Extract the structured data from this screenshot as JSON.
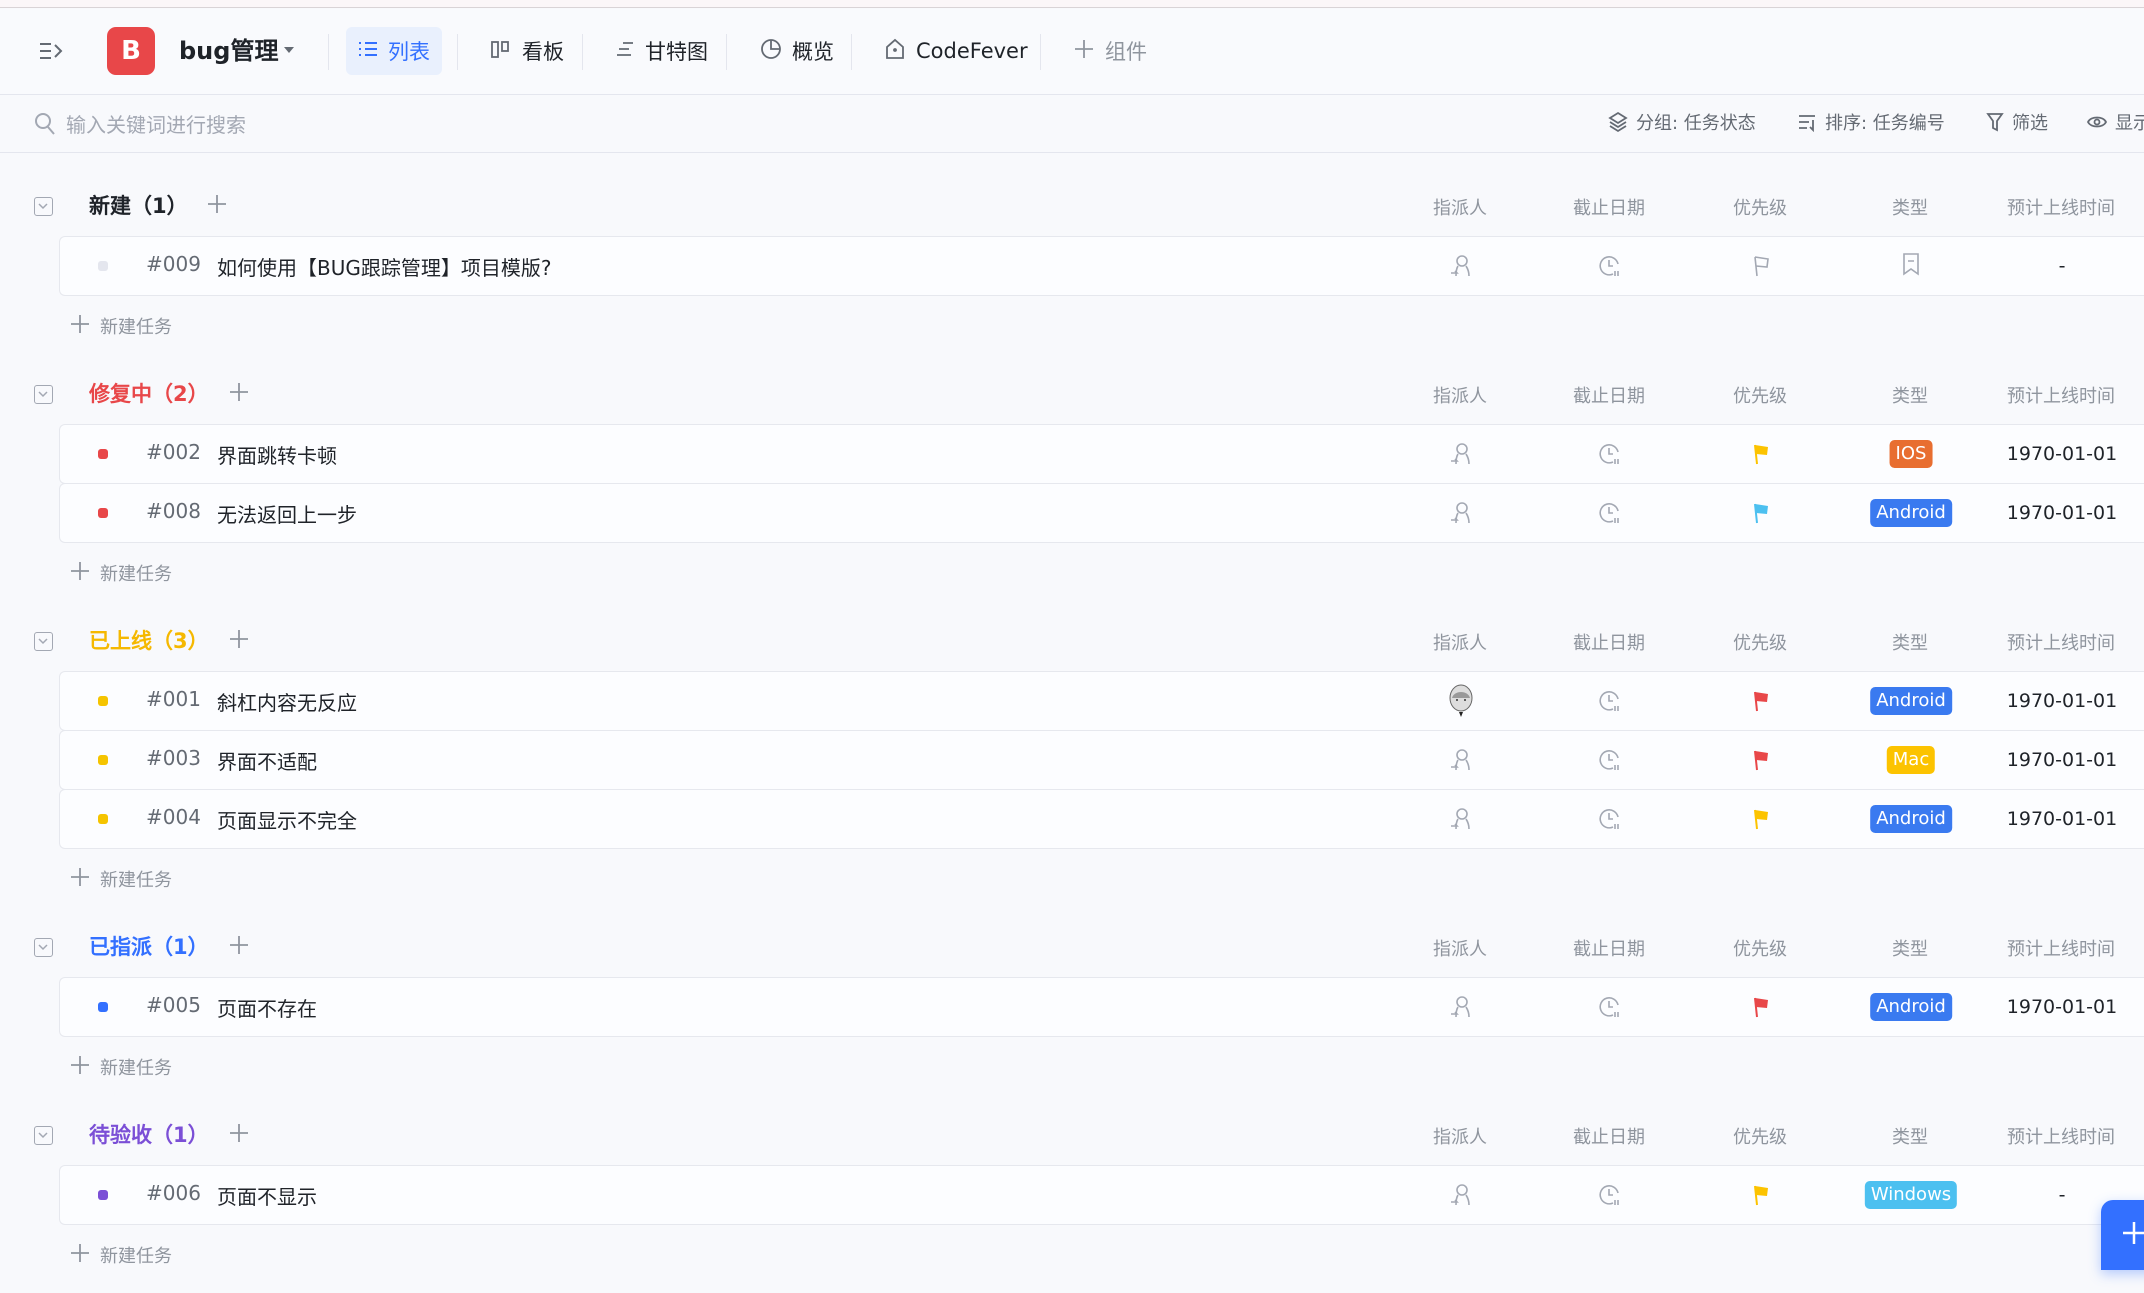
{
  "header": {
    "logo_letter": "B",
    "project_name": "bug管理",
    "tabs": [
      {
        "label": "列表",
        "icon": "list-icon",
        "active": true
      },
      {
        "label": "看板",
        "icon": "kanban-icon"
      },
      {
        "label": "甘特图",
        "icon": "gantt-icon"
      },
      {
        "label": "概览",
        "icon": "pie-chart-icon"
      },
      {
        "label": "CodeFever",
        "icon": "codefever-icon"
      },
      {
        "label": "组件",
        "icon": "plus-icon"
      }
    ]
  },
  "toolbar": {
    "search_placeholder": "输入关键词进行搜索",
    "group_label": "分组: 任务状态",
    "sort_label": "排序: 任务编号",
    "filter_label": "筛选",
    "display_label": "显示"
  },
  "columns": [
    "指派人",
    "截止日期",
    "优先级",
    "类型",
    "预计上线时间"
  ],
  "new_task_label": "新建任务",
  "groups": [
    {
      "title": "新建（1）",
      "color": "#1f2329",
      "dot": "#e4e6ee",
      "tasks": [
        {
          "id": "#009",
          "title": "如何使用【BUG跟踪管理】项目模版?",
          "priority": null,
          "type": null,
          "release": "-"
        }
      ]
    },
    {
      "title": "修复中（2）",
      "color": "#e84749",
      "dot": "#e84749",
      "tasks": [
        {
          "id": "#002",
          "title": "界面跳转卡顿",
          "priority": "#fcc300",
          "type": {
            "label": "IOS",
            "color": "#e86e30"
          },
          "release": "1970-01-01"
        },
        {
          "id": "#008",
          "title": "无法返回上一步",
          "priority": "#4cc0f0",
          "type": {
            "label": "Android",
            "color": "#3a7af0"
          },
          "release": "1970-01-01"
        }
      ]
    },
    {
      "title": "已上线（3）",
      "color": "#f5b800",
      "dot": "#f5c400",
      "tasks": [
        {
          "id": "#001",
          "title": "斜杠内容无反应",
          "assignee_avatar": true,
          "priority": "#e84749",
          "type": {
            "label": "Android",
            "color": "#3a7af0"
          },
          "release": "1970-01-01"
        },
        {
          "id": "#003",
          "title": "界面不适配",
          "priority": "#e84749",
          "type": {
            "label": "Mac",
            "color": "#fcc300"
          },
          "release": "1970-01-01"
        },
        {
          "id": "#004",
          "title": "页面显示不完全",
          "priority": "#fcc300",
          "type": {
            "label": "Android",
            "color": "#3a7af0"
          },
          "release": "1970-01-01"
        }
      ]
    },
    {
      "title": "已指派（1）",
      "color": "#3370ff",
      "dot": "#3370ff",
      "tasks": [
        {
          "id": "#005",
          "title": "页面不存在",
          "priority": "#e84749",
          "type": {
            "label": "Android",
            "color": "#3a7af0"
          },
          "release": "1970-01-01"
        }
      ]
    },
    {
      "title": "待验收（1）",
      "color": "#7b4fd6",
      "dot": "#7b4fd6",
      "tasks": [
        {
          "id": "#006",
          "title": "页面不显示",
          "priority": "#fcc300",
          "type": {
            "label": "Windows",
            "color": "#4cc0f0"
          },
          "release": "-"
        }
      ]
    }
  ]
}
